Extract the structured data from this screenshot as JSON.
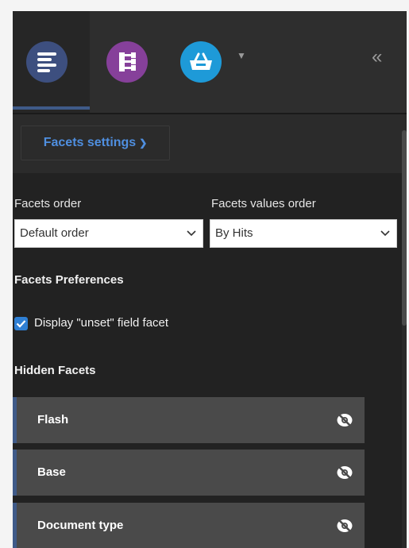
{
  "header": {
    "tabs": [
      {
        "icon": "menu-lines-icon",
        "color": "#3d4f7f",
        "active": true
      },
      {
        "icon": "hierarchy-tree-icon",
        "color": "#86409a",
        "active": false
      },
      {
        "icon": "basket-icon",
        "color": "#1e9ad8",
        "active": false,
        "has_dropdown": true
      }
    ],
    "collapse_glyph": "«"
  },
  "settings": {
    "button_label": "Facets settings",
    "facets_order_label": "Facets order",
    "facets_order_value": "Default order",
    "facets_values_order_label": "Facets values order",
    "facets_values_order_value": "By Hits",
    "preferences_title": "Facets Preferences",
    "display_unset_label": "Display \"unset\" field facet",
    "display_unset_checked": true
  },
  "hidden_facets": {
    "title": "Hidden Facets",
    "items": [
      {
        "label": "Flash"
      },
      {
        "label": "Base"
      },
      {
        "label": "Document type"
      }
    ]
  },
  "colors": {
    "accent": "#4f8fe0",
    "tab_indicator": "#3f5a88",
    "checkbox": "#2f7fd4"
  }
}
